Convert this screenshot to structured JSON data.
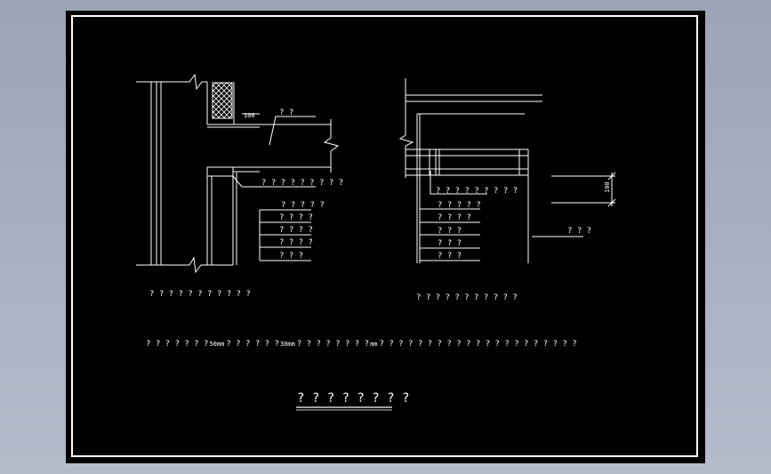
{
  "left_detail": {
    "dim_100": "100",
    "label_top": "? ?",
    "label_mid": "? ? ? ? ? ? ? ? ?",
    "steps": [
      "? ? ? ? ?",
      "? ? ? ?",
      "? ? ? ?",
      "? ? ? ?",
      "? ? ?"
    ],
    "caption": "? ? ? ? ? ? ? ? ? ? ?"
  },
  "right_detail": {
    "label_mid": "? ? ? ? ? ? ? ? ?",
    "steps": [
      "? ? ? ? ?",
      "? ? ? ?",
      "? ? ?",
      "? ? ?",
      "? ? ?"
    ],
    "dim_100": "100",
    "side_label": "? ? ?",
    "caption": "? ? ? ? ? ? ? ? ? ? ?"
  },
  "note": {
    "part1": "? ? ? ? ? ? ?",
    "tag1": "50mm",
    "part2": "? ? ? ? ? ?",
    "tag2": "30mm",
    "part3": "? ? ? ? ? ? ? ?",
    "tag3": "mm",
    "part4": "? ? ? ? ? ? ? ? ? ? ? ? ? ? ? ? ? ? ? ? ?"
  },
  "title": "? ? ? ? ? ? ? ?"
}
